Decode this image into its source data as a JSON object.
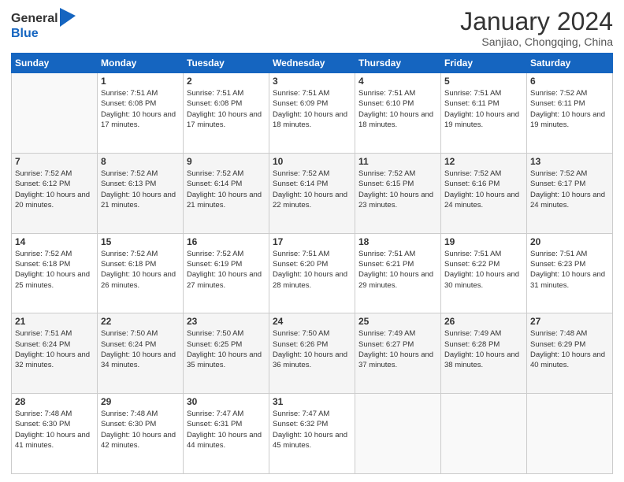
{
  "header": {
    "logo_general": "General",
    "logo_blue": "Blue",
    "month_title": "January 2024",
    "subtitle": "Sanjiao, Chongqing, China"
  },
  "days_of_week": [
    "Sunday",
    "Monday",
    "Tuesday",
    "Wednesday",
    "Thursday",
    "Friday",
    "Saturday"
  ],
  "weeks": [
    [
      {
        "day": "",
        "sunrise": "",
        "sunset": "",
        "daylight": ""
      },
      {
        "day": "1",
        "sunrise": "7:51 AM",
        "sunset": "6:08 PM",
        "daylight": "10 hours and 17 minutes."
      },
      {
        "day": "2",
        "sunrise": "7:51 AM",
        "sunset": "6:08 PM",
        "daylight": "10 hours and 17 minutes."
      },
      {
        "day": "3",
        "sunrise": "7:51 AM",
        "sunset": "6:09 PM",
        "daylight": "10 hours and 18 minutes."
      },
      {
        "day": "4",
        "sunrise": "7:51 AM",
        "sunset": "6:10 PM",
        "daylight": "10 hours and 18 minutes."
      },
      {
        "day": "5",
        "sunrise": "7:51 AM",
        "sunset": "6:11 PM",
        "daylight": "10 hours and 19 minutes."
      },
      {
        "day": "6",
        "sunrise": "7:52 AM",
        "sunset": "6:11 PM",
        "daylight": "10 hours and 19 minutes."
      }
    ],
    [
      {
        "day": "7",
        "sunrise": "7:52 AM",
        "sunset": "6:12 PM",
        "daylight": "10 hours and 20 minutes."
      },
      {
        "day": "8",
        "sunrise": "7:52 AM",
        "sunset": "6:13 PM",
        "daylight": "10 hours and 21 minutes."
      },
      {
        "day": "9",
        "sunrise": "7:52 AM",
        "sunset": "6:14 PM",
        "daylight": "10 hours and 21 minutes."
      },
      {
        "day": "10",
        "sunrise": "7:52 AM",
        "sunset": "6:14 PM",
        "daylight": "10 hours and 22 minutes."
      },
      {
        "day": "11",
        "sunrise": "7:52 AM",
        "sunset": "6:15 PM",
        "daylight": "10 hours and 23 minutes."
      },
      {
        "day": "12",
        "sunrise": "7:52 AM",
        "sunset": "6:16 PM",
        "daylight": "10 hours and 24 minutes."
      },
      {
        "day": "13",
        "sunrise": "7:52 AM",
        "sunset": "6:17 PM",
        "daylight": "10 hours and 24 minutes."
      }
    ],
    [
      {
        "day": "14",
        "sunrise": "7:52 AM",
        "sunset": "6:18 PM",
        "daylight": "10 hours and 25 minutes."
      },
      {
        "day": "15",
        "sunrise": "7:52 AM",
        "sunset": "6:18 PM",
        "daylight": "10 hours and 26 minutes."
      },
      {
        "day": "16",
        "sunrise": "7:52 AM",
        "sunset": "6:19 PM",
        "daylight": "10 hours and 27 minutes."
      },
      {
        "day": "17",
        "sunrise": "7:51 AM",
        "sunset": "6:20 PM",
        "daylight": "10 hours and 28 minutes."
      },
      {
        "day": "18",
        "sunrise": "7:51 AM",
        "sunset": "6:21 PM",
        "daylight": "10 hours and 29 minutes."
      },
      {
        "day": "19",
        "sunrise": "7:51 AM",
        "sunset": "6:22 PM",
        "daylight": "10 hours and 30 minutes."
      },
      {
        "day": "20",
        "sunrise": "7:51 AM",
        "sunset": "6:23 PM",
        "daylight": "10 hours and 31 minutes."
      }
    ],
    [
      {
        "day": "21",
        "sunrise": "7:51 AM",
        "sunset": "6:24 PM",
        "daylight": "10 hours and 32 minutes."
      },
      {
        "day": "22",
        "sunrise": "7:50 AM",
        "sunset": "6:24 PM",
        "daylight": "10 hours and 34 minutes."
      },
      {
        "day": "23",
        "sunrise": "7:50 AM",
        "sunset": "6:25 PM",
        "daylight": "10 hours and 35 minutes."
      },
      {
        "day": "24",
        "sunrise": "7:50 AM",
        "sunset": "6:26 PM",
        "daylight": "10 hours and 36 minutes."
      },
      {
        "day": "25",
        "sunrise": "7:49 AM",
        "sunset": "6:27 PM",
        "daylight": "10 hours and 37 minutes."
      },
      {
        "day": "26",
        "sunrise": "7:49 AM",
        "sunset": "6:28 PM",
        "daylight": "10 hours and 38 minutes."
      },
      {
        "day": "27",
        "sunrise": "7:48 AM",
        "sunset": "6:29 PM",
        "daylight": "10 hours and 40 minutes."
      }
    ],
    [
      {
        "day": "28",
        "sunrise": "7:48 AM",
        "sunset": "6:30 PM",
        "daylight": "10 hours and 41 minutes."
      },
      {
        "day": "29",
        "sunrise": "7:48 AM",
        "sunset": "6:30 PM",
        "daylight": "10 hours and 42 minutes."
      },
      {
        "day": "30",
        "sunrise": "7:47 AM",
        "sunset": "6:31 PM",
        "daylight": "10 hours and 44 minutes."
      },
      {
        "day": "31",
        "sunrise": "7:47 AM",
        "sunset": "6:32 PM",
        "daylight": "10 hours and 45 minutes."
      },
      {
        "day": "",
        "sunrise": "",
        "sunset": "",
        "daylight": ""
      },
      {
        "day": "",
        "sunrise": "",
        "sunset": "",
        "daylight": ""
      },
      {
        "day": "",
        "sunrise": "",
        "sunset": "",
        "daylight": ""
      }
    ]
  ]
}
